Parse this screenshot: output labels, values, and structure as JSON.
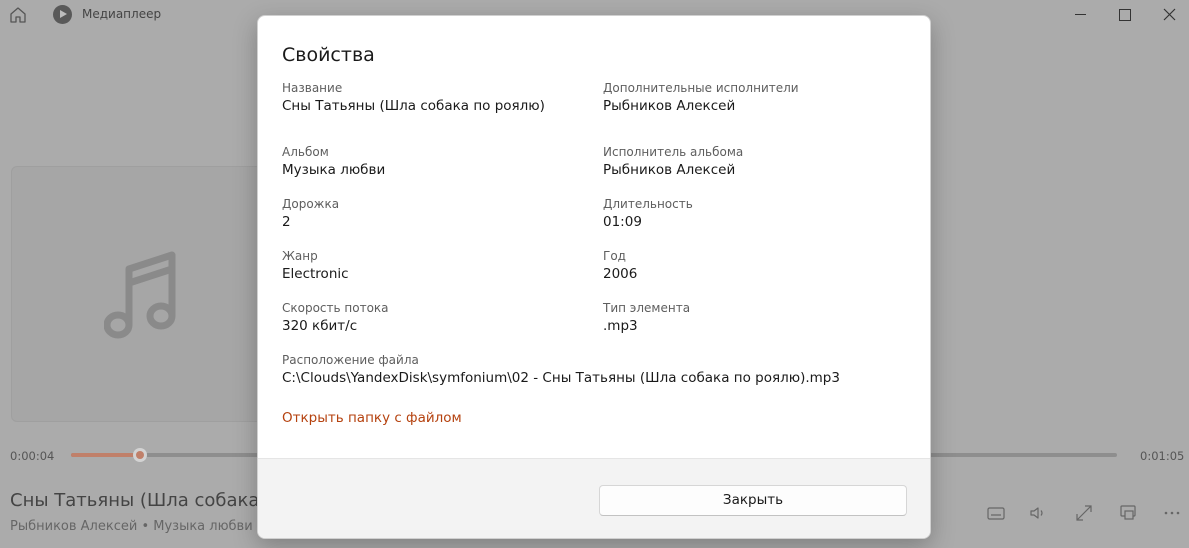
{
  "app": {
    "title": "Медиаплеер",
    "icons": {
      "home": "home-icon",
      "app": "media-player-icon"
    }
  },
  "player": {
    "current_time": "0:00:04",
    "total_time": "0:01:05",
    "progress_fraction": 0.066,
    "now_playing_title": "Сны Татьяны (Шла собака",
    "now_playing_subtitle": "Рыбников Алексей • Музыка любви",
    "accent_color": "#c0806a"
  },
  "dialog": {
    "title": "Свойства",
    "properties": {
      "title": {
        "label": "Название",
        "value": "Сны Татьяны (Шла собака по роялю)"
      },
      "extra_artists": {
        "label": "Дополнительные исполнители",
        "value": "Рыбников Алексей"
      },
      "album": {
        "label": "Альбом",
        "value": "Музыка любви"
      },
      "album_artist": {
        "label": "Исполнитель альбома",
        "value": "Рыбников Алексей"
      },
      "track": {
        "label": "Дорожка",
        "value": "2"
      },
      "duration": {
        "label": "Длительность",
        "value": "01:09"
      },
      "genre": {
        "label": "Жанр",
        "value": "Electronic"
      },
      "year": {
        "label": "Год",
        "value": "2006"
      },
      "bitrate": {
        "label": "Скорость потока",
        "value": "320 кбит/с"
      },
      "item_type": {
        "label": "Тип элемента",
        "value": ".mp3"
      },
      "file_location": {
        "label": "Расположение файла",
        "value": "C:\\Clouds\\YandexDisk\\symfonium\\02 - Сны Татьяны (Шла собака по роялю).mp3"
      }
    },
    "open_folder_label": "Открыть папку с файлом",
    "close_label": "Закрыть",
    "link_color": "#b5420f"
  }
}
